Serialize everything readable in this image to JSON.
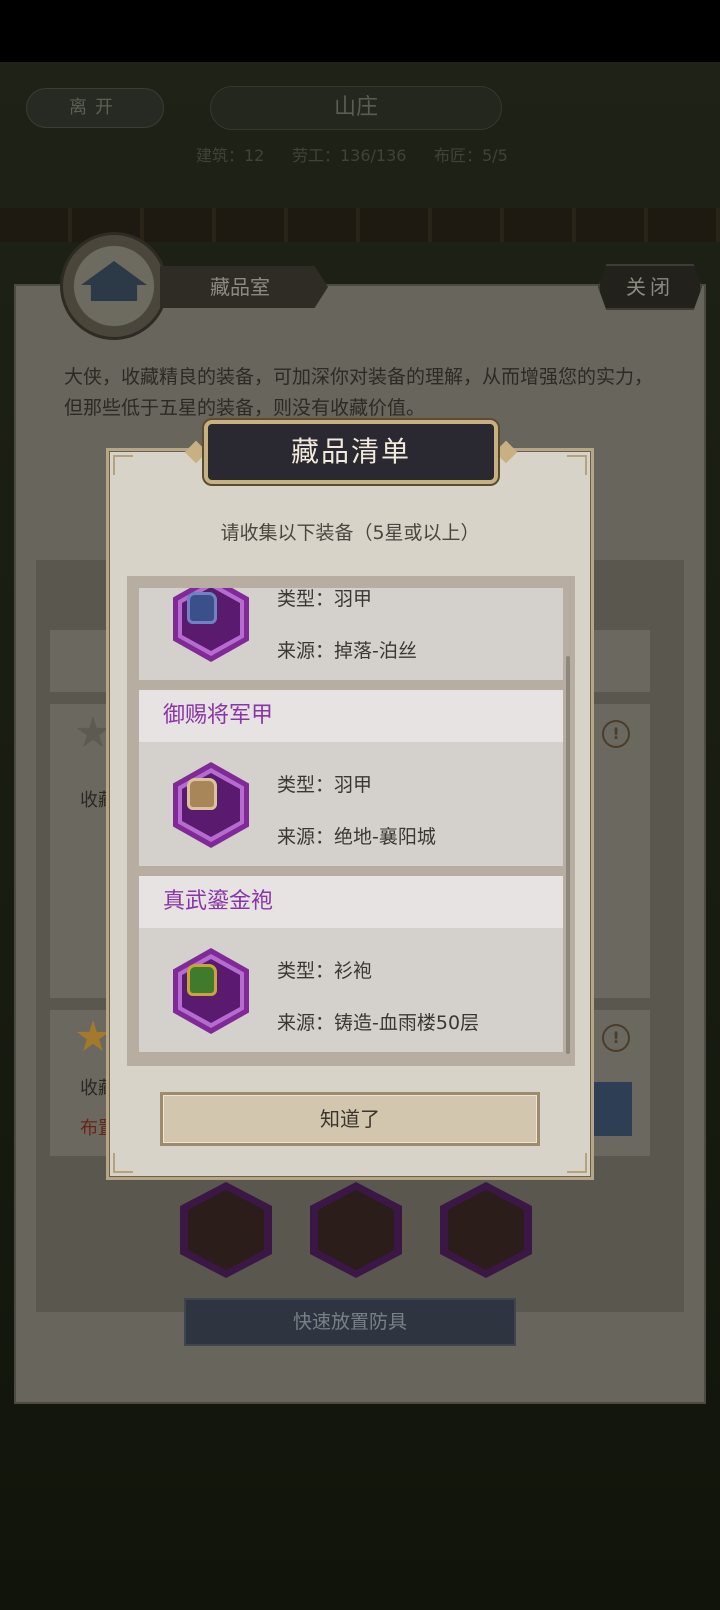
{
  "background": {
    "leave_button": "离开",
    "location_title": "山庄",
    "stats": [
      "建筑：12",
      "劳工：136/136",
      "布匠：5/5"
    ]
  },
  "room": {
    "title": "藏品室",
    "close_label": "关闭",
    "description": "大侠，收藏精良的装备，可加深你对装备的理解，从而增强您的实力，但那些低于五星的装备，则没有收藏价值。",
    "partial_label_1": "收藏",
    "partial_label_2": "收藏",
    "partial_label_3": "布置",
    "quick_place_button": "快速放置防具",
    "colors": {
      "star": "#e0a52a",
      "panel": "#67655c"
    }
  },
  "modal": {
    "title": "藏品清单",
    "subtitle": "请收集以下装备（5星或以上）",
    "type_prefix": "类型：",
    "source_prefix": "来源：",
    "items": [
      {
        "name": "",
        "type": "羽甲",
        "source": "掉落-泊丝",
        "icon": "blue-armor-icon"
      },
      {
        "name": "御赐将军甲",
        "type": "羽甲",
        "source": "绝地-襄阳城",
        "icon": "gold-armor-icon"
      },
      {
        "name": "真武鎏金袍",
        "type": "衫袍",
        "source": "铸造-血雨楼50层",
        "icon": "green-robe-icon"
      }
    ],
    "ok_button": "知道了",
    "colors": {
      "item_name": "#8a35a7",
      "hex_frame": "#7f2a96"
    }
  }
}
